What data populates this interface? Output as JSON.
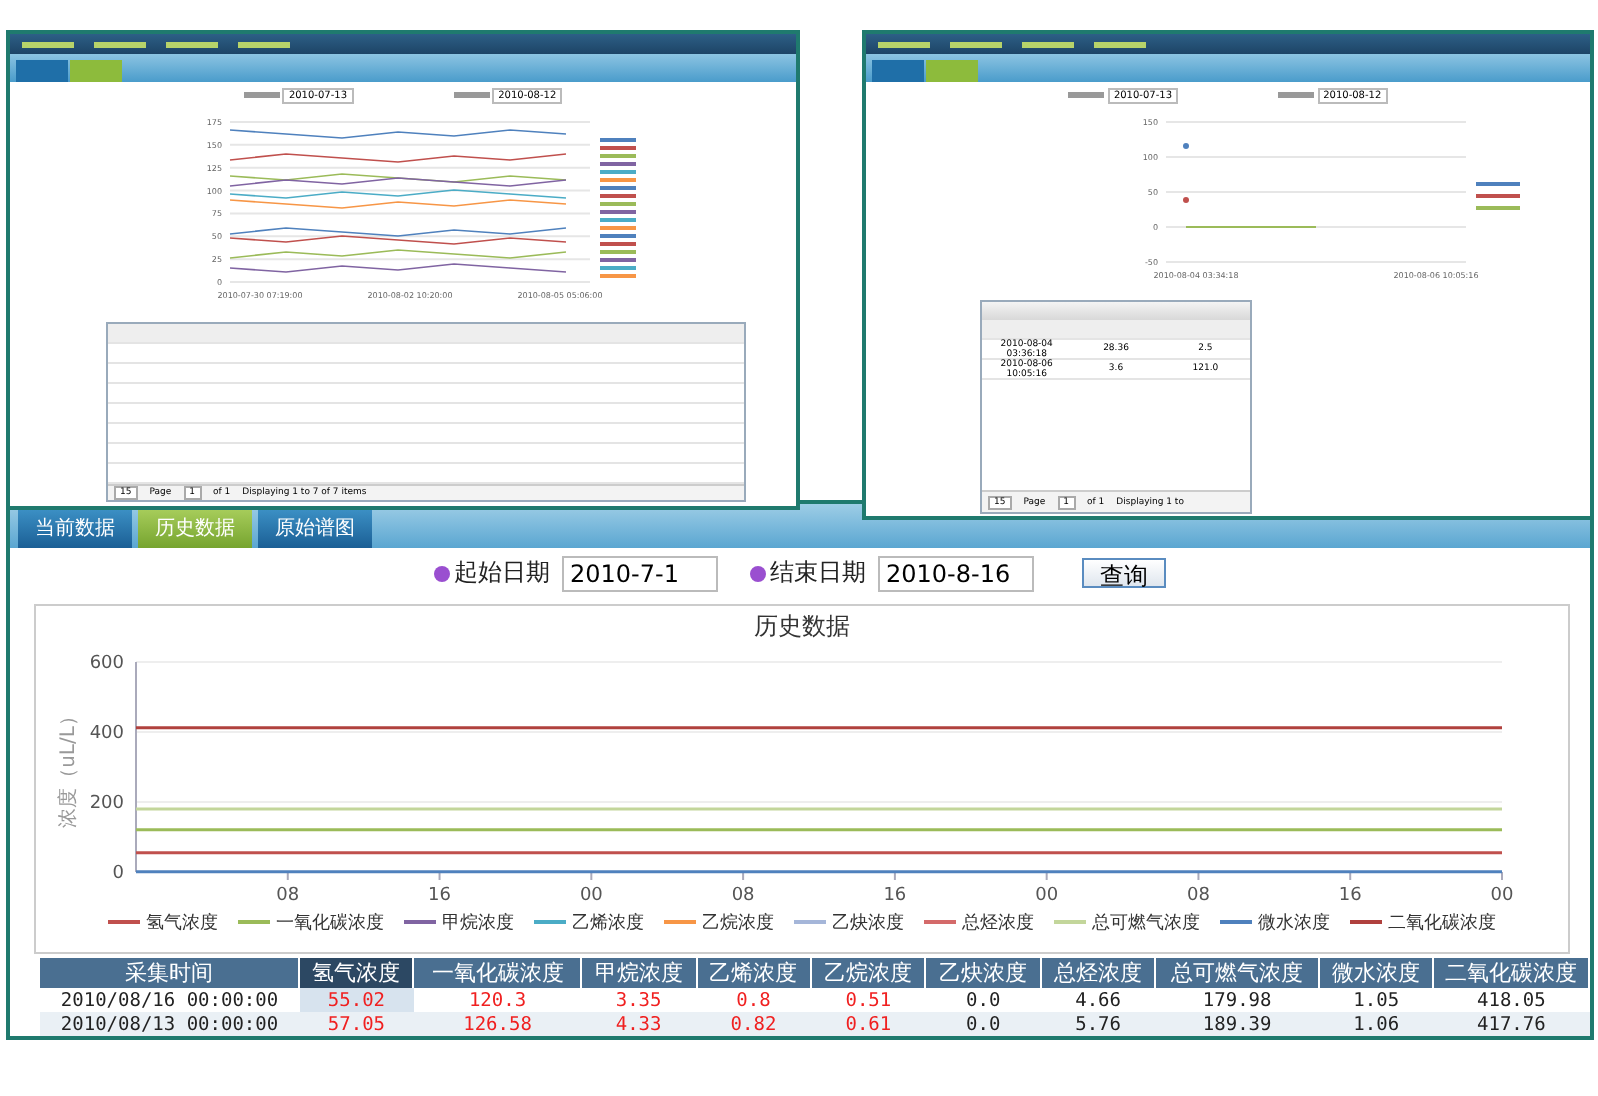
{
  "thumbnails": [
    {
      "kind": "lines",
      "tabs": [
        {
          "selected": false
        },
        {
          "selected": true
        }
      ],
      "start_date": "2010-07-13",
      "end_date": "2010-08-12",
      "yticks": [
        "175",
        "150",
        "125",
        "100",
        "75",
        "50",
        "25",
        "0"
      ],
      "x_labels": [
        "2010-07-30 07:19:00",
        "2010-08-02 10:20:00",
        "2010-08-05 05:06:00"
      ],
      "pager": {
        "page_size": "15",
        "page_label": "Page",
        "page": "1",
        "of": "of 1",
        "status": "Displaying 1 to 7 of 7 items"
      }
    },
    {
      "kind": "points",
      "tabs": [
        {
          "selected": false
        },
        {
          "selected": true
        }
      ],
      "start_date": "2010-07-13",
      "end_date": "2010-08-12",
      "yticks": [
        "150",
        "100",
        "50",
        "0",
        "-50"
      ],
      "x_labels": [
        "2010-08-04 03:34:18",
        "2010-08-06 10:05:16"
      ],
      "rows": [
        [
          "2010-08-04 03:36:18",
          "28.36",
          "2.5"
        ],
        [
          "2010-08-06 10:05:16",
          "3.6",
          "121.0"
        ]
      ],
      "pager": {
        "page_size": "15",
        "page_label": "Page",
        "page": "1",
        "of": "of 1",
        "status": "Displaying 1 to"
      }
    }
  ],
  "tabs": [
    {
      "label": "当前数据",
      "selected": false
    },
    {
      "label": "历史数据",
      "selected": true
    },
    {
      "label": "原始谱图",
      "selected": false
    }
  ],
  "filter": {
    "start_label": "起始日期",
    "start_value": "2010-7-1",
    "end_label": "结束日期",
    "end_value": "2010-8-16",
    "query_button": "查询"
  },
  "chart_data": {
    "type": "line",
    "legend": "bottom",
    "title": "历史数据",
    "ylabel": "浓度（uL/L）",
    "x": [
      0,
      72
    ],
    "xlim": [
      0,
      72
    ],
    "ylim": [
      0,
      600
    ],
    "yticks": [
      0,
      200,
      400,
      600
    ],
    "xticks": [
      {
        "value": 8,
        "label": "08"
      },
      {
        "value": 16,
        "label": "16"
      },
      {
        "value": 24,
        "label": "00"
      },
      {
        "value": 32,
        "label": "08"
      },
      {
        "value": 40,
        "label": "16"
      },
      {
        "value": 48,
        "label": "00"
      },
      {
        "value": 56,
        "label": "08"
      },
      {
        "value": 64,
        "label": "16"
      },
      {
        "value": 72,
        "label": "00"
      }
    ],
    "series": [
      {
        "name": "氢气浓度",
        "color": "#c0504d",
        "values": [
          55,
          55
        ]
      },
      {
        "name": "一氧化碳浓度",
        "color": "#9bbb59",
        "values": [
          121,
          121
        ]
      },
      {
        "name": "甲烷浓度",
        "color": "#8064a2",
        "values": [
          null,
          null
        ]
      },
      {
        "name": "乙烯浓度",
        "color": "#4bacc6",
        "values": [
          null,
          null
        ]
      },
      {
        "name": "乙烷浓度",
        "color": "#f79646",
        "values": [
          null,
          null
        ]
      },
      {
        "name": "乙炔浓度",
        "color": "#a5b6d9",
        "values": [
          null,
          null
        ]
      },
      {
        "name": "总烃浓度",
        "color": "#d46a6a",
        "values": [
          null,
          null
        ]
      },
      {
        "name": "总可燃气浓度",
        "color": "#c3d69b",
        "values": [
          180,
          180
        ]
      },
      {
        "name": "微水浓度",
        "color": "#4f81bd",
        "values": [
          1,
          1
        ]
      },
      {
        "name": "二氧化碳浓度",
        "color": "#b0413e",
        "values": [
          412,
          412
        ]
      }
    ]
  },
  "table": {
    "columns": [
      {
        "label": "采集时间",
        "selected": false,
        "alarm": false
      },
      {
        "label": "氢气浓度",
        "selected": true,
        "alarm": true
      },
      {
        "label": "一氧化碳浓度",
        "selected": false,
        "alarm": true
      },
      {
        "label": "甲烷浓度",
        "selected": false,
        "alarm": true
      },
      {
        "label": "乙烯浓度",
        "selected": false,
        "alarm": true
      },
      {
        "label": "乙烷浓度",
        "selected": false,
        "alarm": true
      },
      {
        "label": "乙炔浓度",
        "selected": false,
        "alarm": false
      },
      {
        "label": "总烃浓度",
        "selected": false,
        "alarm": false
      },
      {
        "label": "总可燃气浓度",
        "selected": false,
        "alarm": false
      },
      {
        "label": "微水浓度",
        "selected": false,
        "alarm": false
      },
      {
        "label": "二氧化碳浓度",
        "selected": false,
        "alarm": false
      }
    ],
    "rows": [
      [
        "2010/08/16 00:00:00",
        "55.02",
        "120.3",
        "3.35",
        "0.8",
        "0.51",
        "0.0",
        "4.66",
        "179.98",
        "1.05",
        "418.05"
      ],
      [
        "2010/08/13 00:00:00",
        "57.05",
        "126.58",
        "4.33",
        "0.82",
        "0.61",
        "0.0",
        "5.76",
        "189.39",
        "1.06",
        "417.76"
      ]
    ]
  }
}
